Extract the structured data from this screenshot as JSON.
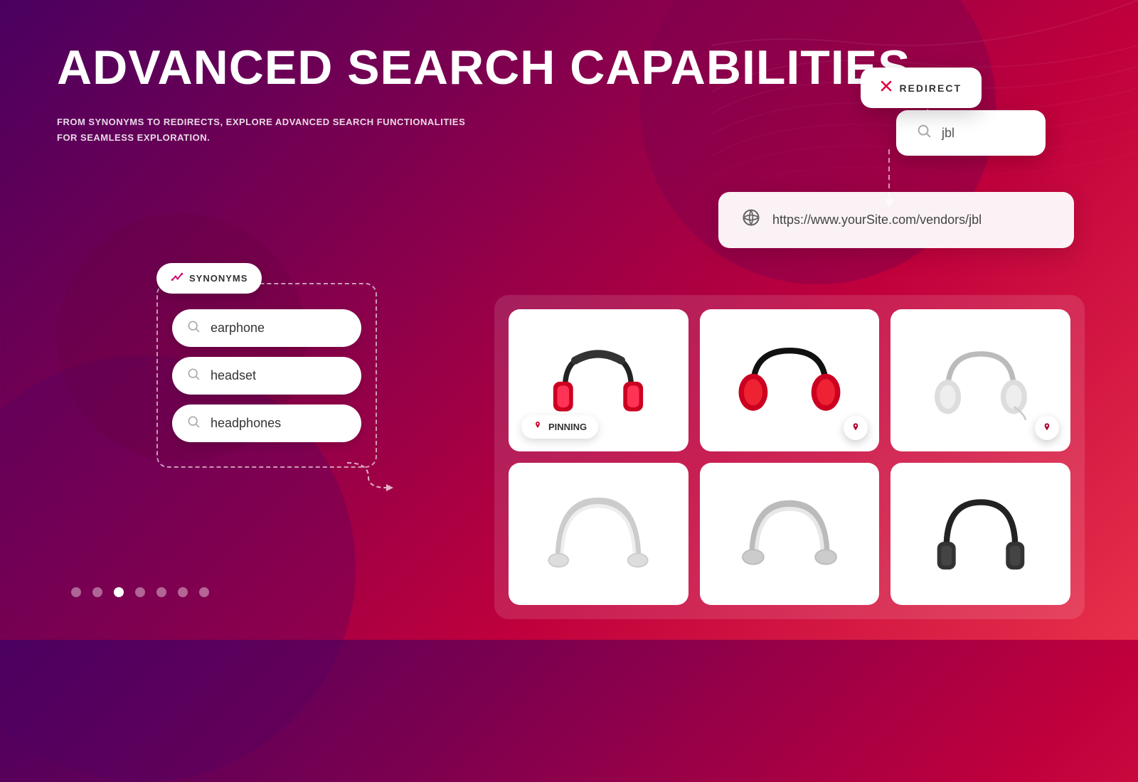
{
  "page": {
    "title": "ADVANCED SEARCH CAPABILITIES",
    "subtitle_line1": "FROM SYNONYMS TO REDIRECTS, EXPLORE ADVANCED SEARCH FUNCTIONALITIES",
    "subtitle_line2": "FOR SEAMLESS EXPLORATION."
  },
  "synonyms": {
    "badge_text": "SYNONYMS",
    "items": [
      {
        "text": "earphone"
      },
      {
        "text": "headset"
      },
      {
        "text": "headphones"
      }
    ]
  },
  "redirect": {
    "label": "REDIRECT",
    "search_value": "jbl",
    "url": "https://www.yourSite.com/vendors/jbl"
  },
  "pinning": {
    "label": "PINNING"
  },
  "pagination": {
    "total_dots": 7,
    "active_index": 2
  },
  "products": [
    {
      "id": 1,
      "color": "red",
      "style": "folding",
      "pinning": true
    },
    {
      "id": 2,
      "color": "red",
      "style": "over-ear",
      "pinned": true
    },
    {
      "id": 3,
      "color": "white",
      "style": "over-ear",
      "pinned": true
    },
    {
      "id": 4,
      "color": "silver",
      "style": "on-ear",
      "pinned": false
    },
    {
      "id": 5,
      "color": "silver",
      "style": "on-ear-2",
      "pinned": false
    },
    {
      "id": 6,
      "color": "black",
      "style": "on-ear-3",
      "pinned": false
    }
  ],
  "icons": {
    "search": "🔍",
    "globe": "🌐",
    "pin": "📌",
    "chart": "📈",
    "redirect_x": "✕"
  }
}
